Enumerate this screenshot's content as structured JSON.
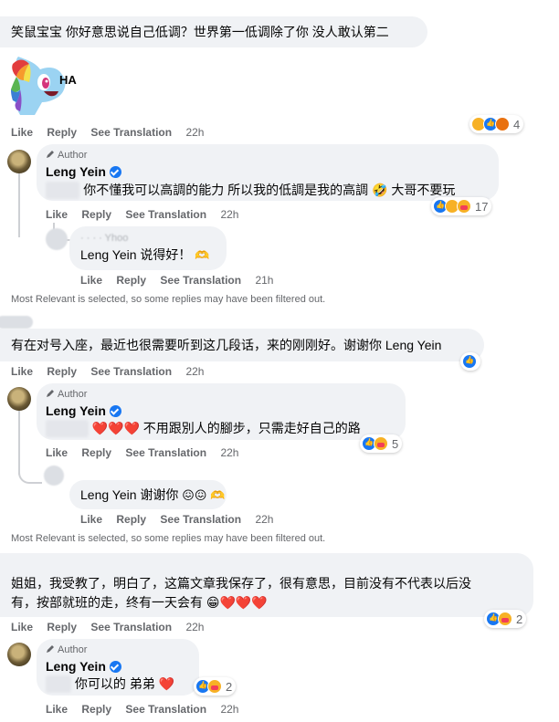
{
  "common": {
    "like": "Like",
    "reply": "Reply",
    "see_translation": "See Translation",
    "author_badge": "Author",
    "filtered_notice": "Most Relevant is selected, so some replies may have been filtered out."
  },
  "c1": {
    "text": "笑鼠宝宝 你好意思说自己低调？世界第一低调除了你 没人敢认第二",
    "sticker_text": "HA",
    "time": "22h",
    "reactions": [
      "haha",
      "like",
      "angry"
    ],
    "reaction_count": "4"
  },
  "r1": {
    "author": "Leng Yein",
    "text": "你不懂我可以高調的能力 所以我的低調是我的高調 🤣 大哥不要玩",
    "time": "22h",
    "reactions": [
      "like",
      "haha",
      "care"
    ],
    "reaction_count": "17"
  },
  "r1b": {
    "author_blurred": "· · · · Yhoo",
    "text": "Leng Yein 说得好！",
    "emoji": "🫶",
    "time": "21h"
  },
  "c2": {
    "text": "有在对号入座，最近也很需要听到这几段话，来的刚刚好。谢谢你 Leng Yein",
    "time": "22h",
    "reactions": [
      "like"
    ]
  },
  "r2": {
    "author": "Leng Yein",
    "text": "❤️❤️❤️ 不用跟別人的腳步，只需走好自己的路",
    "time": "22h",
    "reactions": [
      "like",
      "care"
    ],
    "reaction_count": "5"
  },
  "r2b": {
    "text": "Leng Yein 谢谢你",
    "emoji": "😖😖 🫶",
    "time": "22h"
  },
  "c3": {
    "line1": "姐姐，我受教了，明白了，这篇文章我保存了，很有意思，目前没有不代表以后没",
    "line2": "有，按部就班的走，终有一天会有 😁❤️❤️❤️",
    "time": "22h",
    "reactions": [
      "like",
      "care"
    ],
    "reaction_count": "2"
  },
  "r3": {
    "author": "Leng Yein",
    "text": "你可以的 弟弟 ❤️",
    "time": "22h",
    "reactions": [
      "like",
      "care"
    ],
    "reaction_count": "2"
  }
}
